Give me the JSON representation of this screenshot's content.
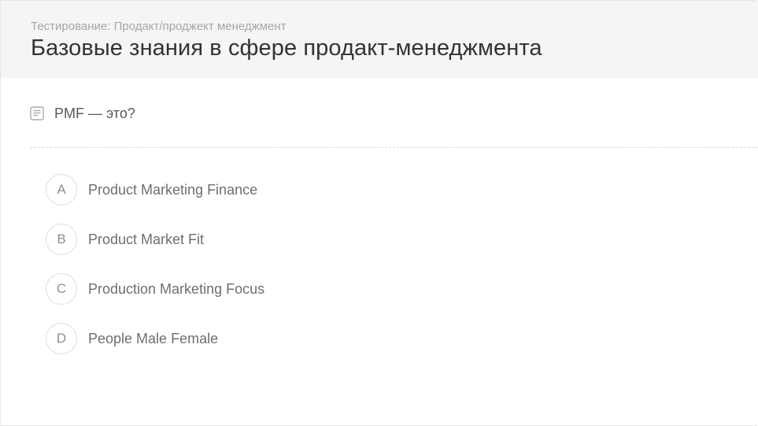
{
  "header": {
    "breadcrumb": "Тестирование: Продакт/проджект менеджмент",
    "title": "Базовые знания в сфере продакт-менеджмента"
  },
  "question": {
    "icon": "document-icon",
    "text": "PMF — это?"
  },
  "options": [
    {
      "letter": "A",
      "label": "Product Marketing Finance"
    },
    {
      "letter": "B",
      "label": "Product Market Fit"
    },
    {
      "letter": "C",
      "label": "Production Marketing Focus"
    },
    {
      "letter": "D",
      "label": "People Male Female"
    }
  ],
  "colors": {
    "header_bg": "#f5f5f5",
    "title": "#333333",
    "breadcrumb": "#a3a7ab",
    "option_text": "#6b6f73",
    "circle_border": "#dedede"
  }
}
